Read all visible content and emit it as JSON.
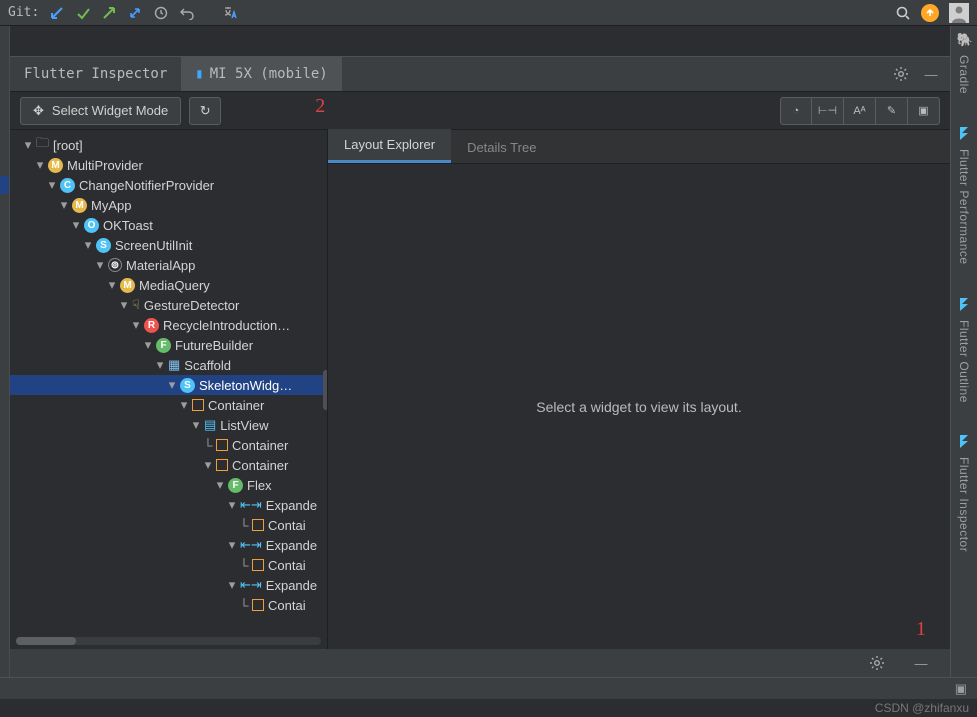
{
  "toolbar": {
    "git_label": "Git:"
  },
  "header": {
    "tab_inspector": "Flutter Inspector",
    "tab_device": "MI 5X (mobile)"
  },
  "tools": {
    "select_widget": "Select Widget Mode"
  },
  "detail": {
    "tab_layout": "Layout Explorer",
    "tab_details": "Details Tree",
    "placeholder": "Select a widget to view its layout."
  },
  "sidebar": {
    "gradle": "Gradle",
    "perf": "Flutter Performance",
    "outline": "Flutter Outline",
    "insp": "Flutter Inspector"
  },
  "tree": [
    {
      "d": 0,
      "ico": "folder",
      "label": "[root]",
      "sel": false
    },
    {
      "d": 1,
      "ico": "m",
      "label": "MultiProvider",
      "sel": false
    },
    {
      "d": 2,
      "ico": "c",
      "label": "ChangeNotifierProvider<AppProv…",
      "sel": false
    },
    {
      "d": 3,
      "ico": "m",
      "label": "MyApp",
      "sel": false
    },
    {
      "d": 4,
      "ico": "o",
      "label": "OKToast",
      "sel": false
    },
    {
      "d": 5,
      "ico": "s",
      "label": "ScreenUtilInit",
      "sel": false
    },
    {
      "d": 6,
      "ico": "w",
      "label": "MaterialApp",
      "sel": false
    },
    {
      "d": 7,
      "ico": "m",
      "label": "MediaQuery",
      "sel": false
    },
    {
      "d": 8,
      "ico": "gest",
      "label": "GestureDetector",
      "sel": false
    },
    {
      "d": 9,
      "ico": "r",
      "label": "RecycleIntroduction…",
      "sel": false
    },
    {
      "d": 10,
      "ico": "f",
      "label": "FutureBuilder<dy…",
      "sel": false
    },
    {
      "d": 11,
      "ico": "scaf",
      "label": "Scaffold",
      "sel": false
    },
    {
      "d": 12,
      "ico": "s",
      "label": "SkeletonWidg…",
      "sel": true
    },
    {
      "d": 13,
      "ico": "rect",
      "label": "Container",
      "sel": false
    },
    {
      "d": 14,
      "ico": "list",
      "label": "ListView",
      "sel": false
    },
    {
      "d": 15,
      "ico": "rect",
      "label": "Container",
      "sel": false,
      "leaf": true
    },
    {
      "d": 15,
      "ico": "rect",
      "label": "Container",
      "sel": false
    },
    {
      "d": 16,
      "ico": "f",
      "label": "Flex",
      "sel": false
    },
    {
      "d": 17,
      "ico": "exp",
      "label": "Expande",
      "sel": false
    },
    {
      "d": 18,
      "ico": "rect",
      "label": "Contai",
      "sel": false,
      "leaf": true
    },
    {
      "d": 17,
      "ico": "exp",
      "label": "Expande",
      "sel": false
    },
    {
      "d": 18,
      "ico": "rect",
      "label": "Contai",
      "sel": false,
      "leaf": true
    },
    {
      "d": 17,
      "ico": "exp",
      "label": "Expande",
      "sel": false
    },
    {
      "d": 18,
      "ico": "rect",
      "label": "Contai",
      "sel": false,
      "leaf": true
    }
  ],
  "annotations": {
    "one": "1",
    "two": "2"
  },
  "watermark": "CSDN @zhifanxu"
}
